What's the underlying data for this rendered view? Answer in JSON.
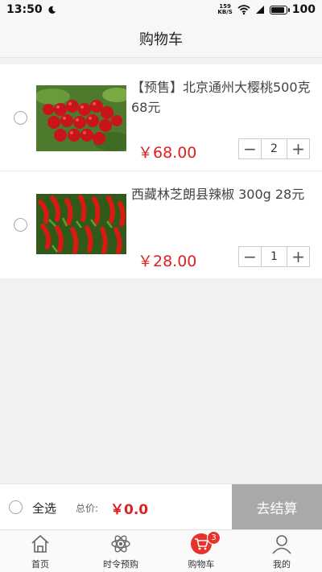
{
  "status_bar": {
    "time": "13:50",
    "net_speed_value": "159",
    "net_speed_unit": "KB/S",
    "battery": "100"
  },
  "nav": {
    "title": "购物车"
  },
  "cart": {
    "items": [
      {
        "name": "【预售】北京通州大樱桃500克 68元",
        "price": "￥68.00",
        "quantity": "2",
        "image": "cherries"
      },
      {
        "name": "西藏林芝朗县辣椒 300g 28元",
        "price": "￥28.00",
        "quantity": "1",
        "image": "red-peppers"
      }
    ]
  },
  "checkout": {
    "select_all_label": "全选",
    "total_label": "总价:",
    "total_value": "￥0.0",
    "checkout_label": "去结算"
  },
  "tabs": {
    "home": "首页",
    "seasonal": "时令预购",
    "cart": "购物车",
    "cart_badge": "3",
    "mine": "我的"
  },
  "colors": {
    "price_red": "#e02020",
    "checkout_gray": "#a9a9a9",
    "cart_tab_red": "#e8332c"
  }
}
